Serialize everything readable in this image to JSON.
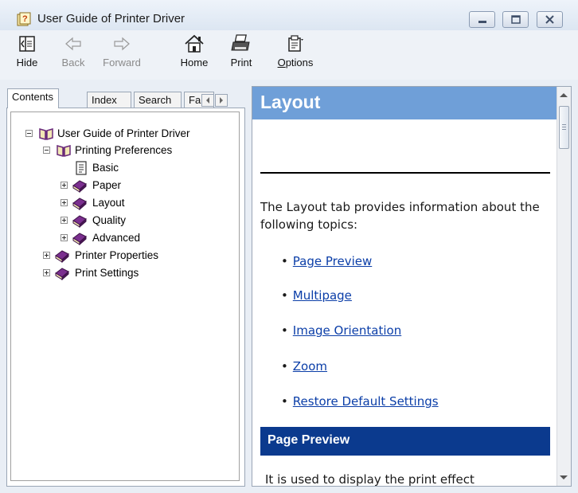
{
  "window": {
    "title": "User Guide of Printer Driver"
  },
  "toolbar": {
    "buttons": [
      {
        "label": "Hide",
        "icon": "hide-icon",
        "enabled": true
      },
      {
        "label": "Back",
        "icon": "back-arrow-icon",
        "enabled": false
      },
      {
        "label": "Forward",
        "icon": "forward-arrow-icon",
        "enabled": false
      },
      {
        "label": "Home",
        "icon": "home-icon",
        "enabled": true
      },
      {
        "label": "Print",
        "icon": "printer-icon",
        "enabled": true
      },
      {
        "label": "Options",
        "icon": "options-icon",
        "enabled": true
      }
    ]
  },
  "nav": {
    "tabs": [
      "Contents",
      "Index",
      "Search",
      "Fa"
    ],
    "active_tab": "Contents",
    "tree": [
      {
        "label": "User Guide of Printer Driver",
        "icon": "open-book-icon",
        "expander": "minus"
      },
      {
        "label": "Printing Preferences",
        "icon": "open-book-icon",
        "expander": "minus"
      },
      {
        "label": "Basic",
        "icon": "page-icon",
        "expander": "none"
      },
      {
        "label": "Paper",
        "icon": "closed-book-icon",
        "expander": "plus"
      },
      {
        "label": "Layout",
        "icon": "closed-book-icon",
        "expander": "plus",
        "selected": true
      },
      {
        "label": "Quality",
        "icon": "closed-book-icon",
        "expander": "plus"
      },
      {
        "label": "Advanced",
        "icon": "closed-book-icon",
        "expander": "plus"
      },
      {
        "label": "Printer Properties",
        "icon": "closed-book-icon",
        "expander": "plus"
      },
      {
        "label": "Print Settings",
        "icon": "closed-book-icon",
        "expander": "plus"
      }
    ]
  },
  "content": {
    "heading": "Layout",
    "intro": "The Layout tab provides information about the following topics:",
    "links": [
      "Page Preview",
      "Multipage",
      "Image Orientation",
      "Zoom",
      "Restore Default Settings"
    ],
    "section_heading": "Page Preview",
    "section_text": "It is used to display the print effect"
  },
  "colors": {
    "heading_band": "#6f9fd8",
    "section_band": "#0b3a8e",
    "link": "#0b3ea8",
    "book": "#6a2a7a"
  }
}
